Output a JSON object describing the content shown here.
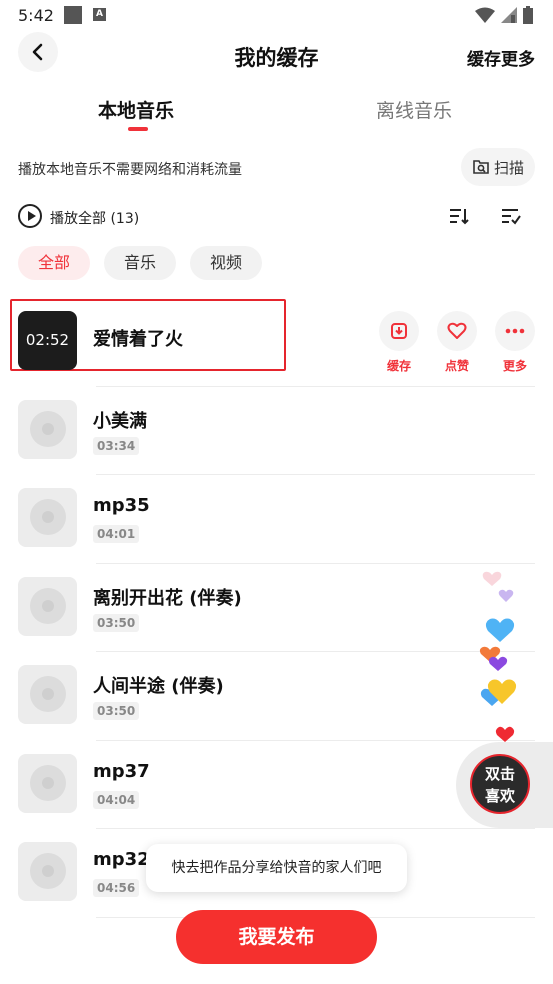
{
  "status_bar": {
    "time": "5:42"
  },
  "header": {
    "title": "我的缓存",
    "right_action": "缓存更多"
  },
  "tabs": [
    {
      "label": "本地音乐",
      "active": true
    },
    {
      "label": "离线音乐",
      "active": false
    }
  ],
  "info": {
    "text": "播放本地音乐不需要网络和消耗流量",
    "scan_label": "扫描"
  },
  "play_all": {
    "label": "播放全部",
    "count": "(13)"
  },
  "filters": [
    {
      "label": "全部",
      "active": true
    },
    {
      "label": "音乐",
      "active": false
    },
    {
      "label": "视频",
      "active": false
    }
  ],
  "songs": [
    {
      "title": "爱情着了火",
      "duration": "02:52",
      "type": "video",
      "highlighted": true
    },
    {
      "title": "小美满",
      "duration": "03:34",
      "type": "audio"
    },
    {
      "title": "mp35",
      "duration": "04:01",
      "type": "audio"
    },
    {
      "title": "离别开出花 (伴奏)",
      "duration": "03:50",
      "type": "audio"
    },
    {
      "title": "人间半途 (伴奏)",
      "duration": "03:50",
      "type": "audio"
    },
    {
      "title": "mp37",
      "duration": "04:04",
      "type": "audio"
    },
    {
      "title": "mp32",
      "duration": "04:56",
      "type": "audio"
    }
  ],
  "song_actions": [
    {
      "label": "缓存",
      "icon": "download-icon"
    },
    {
      "label": "点赞",
      "icon": "heart-icon"
    },
    {
      "label": "更多",
      "icon": "more-icon"
    }
  ],
  "like_float": {
    "line1": "双击",
    "line2": "喜欢"
  },
  "tooltip": {
    "text": "快去把作品分享给快音的家人们吧"
  },
  "publish_button": {
    "label": "我要发布"
  },
  "colors": {
    "accent": "#f0323a",
    "publish": "#f5302e"
  }
}
